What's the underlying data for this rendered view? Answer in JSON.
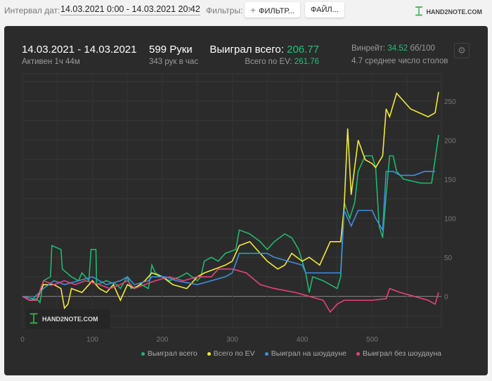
{
  "toolbar": {
    "interval_label": "Интервал дат:",
    "interval_value": "14.03.2021 0:00 - 14.03.2021 20:42",
    "filters_label": "Фильтры:",
    "filter_button": "ФИЛЬТР...",
    "file_button": "ФАЙЛ...",
    "logo": "HAND2NOTE.COM"
  },
  "summary": {
    "date_range": "14.03.2021 - 14.03.2021",
    "active": "Активен 1ч 44м",
    "hands": "599 Руки",
    "hands_per_hour": "343 рук в час",
    "won_label": "Выиграл всего:",
    "won_value": "206.77",
    "ev_label": "Всего по EV:",
    "ev_value": "261.76",
    "winrate_label": "Винрейт:",
    "winrate_value": "34.52",
    "winrate_unit": "бб/100",
    "tables": "4.7 среднее число столов"
  },
  "watermark": "HAND2NOTE.COM",
  "chart_data": {
    "type": "line",
    "xlim": [
      0,
      599
    ],
    "ylim": [
      -40,
      285
    ],
    "xticks": [
      0,
      100,
      200,
      300,
      400,
      500
    ],
    "yticks": [
      0,
      50,
      100,
      150,
      200,
      250
    ],
    "legend_position": "bottom-right",
    "series": [
      {
        "name": "Выиграл всего",
        "color": "#1fb86e",
        "points": [
          [
            0,
            0
          ],
          [
            10,
            -5
          ],
          [
            20,
            -3
          ],
          [
            25,
            -8
          ],
          [
            30,
            20
          ],
          [
            40,
            25
          ],
          [
            42,
            65
          ],
          [
            55,
            60
          ],
          [
            57,
            35
          ],
          [
            70,
            25
          ],
          [
            80,
            20
          ],
          [
            85,
            30
          ],
          [
            95,
            20
          ],
          [
            98,
            60
          ],
          [
            105,
            60
          ],
          [
            106,
            15
          ],
          [
            120,
            20
          ],
          [
            135,
            15
          ],
          [
            140,
            10
          ],
          [
            150,
            25
          ],
          [
            155,
            10
          ],
          [
            170,
            15
          ],
          [
            180,
            10
          ],
          [
            185,
            40
          ],
          [
            190,
            30
          ],
          [
            210,
            20
          ],
          [
            225,
            25
          ],
          [
            235,
            30
          ],
          [
            250,
            20
          ],
          [
            255,
            25
          ],
          [
            260,
            45
          ],
          [
            270,
            50
          ],
          [
            280,
            45
          ],
          [
            290,
            55
          ],
          [
            305,
            60
          ],
          [
            310,
            85
          ],
          [
            325,
            80
          ],
          [
            340,
            70
          ],
          [
            350,
            60
          ],
          [
            360,
            70
          ],
          [
            375,
            80
          ],
          [
            385,
            75
          ],
          [
            395,
            60
          ],
          [
            405,
            30
          ],
          [
            410,
            5
          ],
          [
            415,
            25
          ],
          [
            430,
            20
          ],
          [
            450,
            10
          ],
          [
            455,
            25
          ],
          [
            460,
            120
          ],
          [
            468,
            100
          ],
          [
            475,
            120
          ],
          [
            480,
            160
          ],
          [
            490,
            180
          ],
          [
            500,
            180
          ],
          [
            505,
            165
          ],
          [
            510,
            90
          ],
          [
            515,
            75
          ],
          [
            520,
            130
          ],
          [
            525,
            180
          ],
          [
            530,
            180
          ],
          [
            535,
            160
          ],
          [
            545,
            150
          ],
          [
            570,
            145
          ],
          [
            585,
            145
          ],
          [
            590,
            175
          ],
          [
            595,
            206.77
          ]
        ]
      },
      {
        "name": "Всего по EV",
        "color": "#f0ea3a",
        "points": [
          [
            0,
            0
          ],
          [
            10,
            -5
          ],
          [
            20,
            -5
          ],
          [
            30,
            15
          ],
          [
            45,
            15
          ],
          [
            55,
            10
          ],
          [
            60,
            -15
          ],
          [
            65,
            -10
          ],
          [
            70,
            10
          ],
          [
            85,
            5
          ],
          [
            100,
            20
          ],
          [
            110,
            10
          ],
          [
            120,
            5
          ],
          [
            130,
            15
          ],
          [
            140,
            -5
          ],
          [
            150,
            15
          ],
          [
            160,
            10
          ],
          [
            175,
            20
          ],
          [
            185,
            30
          ],
          [
            200,
            25
          ],
          [
            215,
            15
          ],
          [
            235,
            10
          ],
          [
            250,
            25
          ],
          [
            260,
            30
          ],
          [
            275,
            35
          ],
          [
            290,
            40
          ],
          [
            300,
            45
          ],
          [
            310,
            65
          ],
          [
            325,
            70
          ],
          [
            340,
            55
          ],
          [
            350,
            45
          ],
          [
            365,
            35
          ],
          [
            375,
            40
          ],
          [
            385,
            55
          ],
          [
            400,
            45
          ],
          [
            410,
            50
          ],
          [
            425,
            40
          ],
          [
            440,
            70
          ],
          [
            455,
            70
          ],
          [
            460,
            115
          ],
          [
            465,
            215
          ],
          [
            470,
            130
          ],
          [
            480,
            200
          ],
          [
            490,
            175
          ],
          [
            500,
            170
          ],
          [
            505,
            165
          ],
          [
            515,
            180
          ],
          [
            520,
            240
          ],
          [
            525,
            230
          ],
          [
            535,
            260
          ],
          [
            545,
            250
          ],
          [
            555,
            240
          ],
          [
            580,
            230
          ],
          [
            590,
            235
          ],
          [
            595,
            261.76
          ]
        ]
      },
      {
        "name": "Выиграл на шоудауне",
        "color": "#3d8fe0",
        "points": [
          [
            0,
            0
          ],
          [
            15,
            -3
          ],
          [
            30,
            10
          ],
          [
            45,
            20
          ],
          [
            60,
            15
          ],
          [
            80,
            20
          ],
          [
            100,
            25
          ],
          [
            110,
            20
          ],
          [
            120,
            15
          ],
          [
            140,
            20
          ],
          [
            150,
            25
          ],
          [
            160,
            15
          ],
          [
            180,
            20
          ],
          [
            185,
            25
          ],
          [
            205,
            25
          ],
          [
            220,
            20
          ],
          [
            250,
            15
          ],
          [
            270,
            20
          ],
          [
            290,
            25
          ],
          [
            300,
            30
          ],
          [
            310,
            55
          ],
          [
            340,
            55
          ],
          [
            350,
            55
          ],
          [
            360,
            50
          ],
          [
            380,
            45
          ],
          [
            400,
            40
          ],
          [
            405,
            30
          ],
          [
            455,
            30
          ],
          [
            460,
            110
          ],
          [
            470,
            90
          ],
          [
            480,
            110
          ],
          [
            500,
            110
          ],
          [
            505,
            100
          ],
          [
            515,
            85
          ],
          [
            520,
            160
          ],
          [
            530,
            160
          ],
          [
            540,
            155
          ],
          [
            560,
            155
          ],
          [
            575,
            160
          ],
          [
            590,
            160
          ]
        ]
      },
      {
        "name": "Выиграл без шоудауна",
        "color": "#e8417a",
        "points": [
          [
            0,
            0
          ],
          [
            10,
            -5
          ],
          [
            20,
            -5
          ],
          [
            30,
            20
          ],
          [
            45,
            15
          ],
          [
            60,
            20
          ],
          [
            75,
            15
          ],
          [
            90,
            20
          ],
          [
            110,
            15
          ],
          [
            125,
            10
          ],
          [
            140,
            15
          ],
          [
            150,
            20
          ],
          [
            160,
            10
          ],
          [
            175,
            15
          ],
          [
            190,
            20
          ],
          [
            210,
            25
          ],
          [
            230,
            20
          ],
          [
            250,
            25
          ],
          [
            270,
            25
          ],
          [
            280,
            35
          ],
          [
            300,
            35
          ],
          [
            320,
            30
          ],
          [
            340,
            15
          ],
          [
            360,
            10
          ],
          [
            390,
            5
          ],
          [
            410,
            0
          ],
          [
            430,
            -5
          ],
          [
            440,
            -20
          ],
          [
            450,
            -10
          ],
          [
            460,
            -5
          ],
          [
            480,
            -5
          ],
          [
            500,
            -5
          ],
          [
            520,
            -3
          ],
          [
            525,
            10
          ],
          [
            540,
            5
          ],
          [
            560,
            0
          ],
          [
            580,
            -5
          ],
          [
            590,
            -10
          ],
          [
            595,
            5
          ]
        ]
      }
    ]
  }
}
